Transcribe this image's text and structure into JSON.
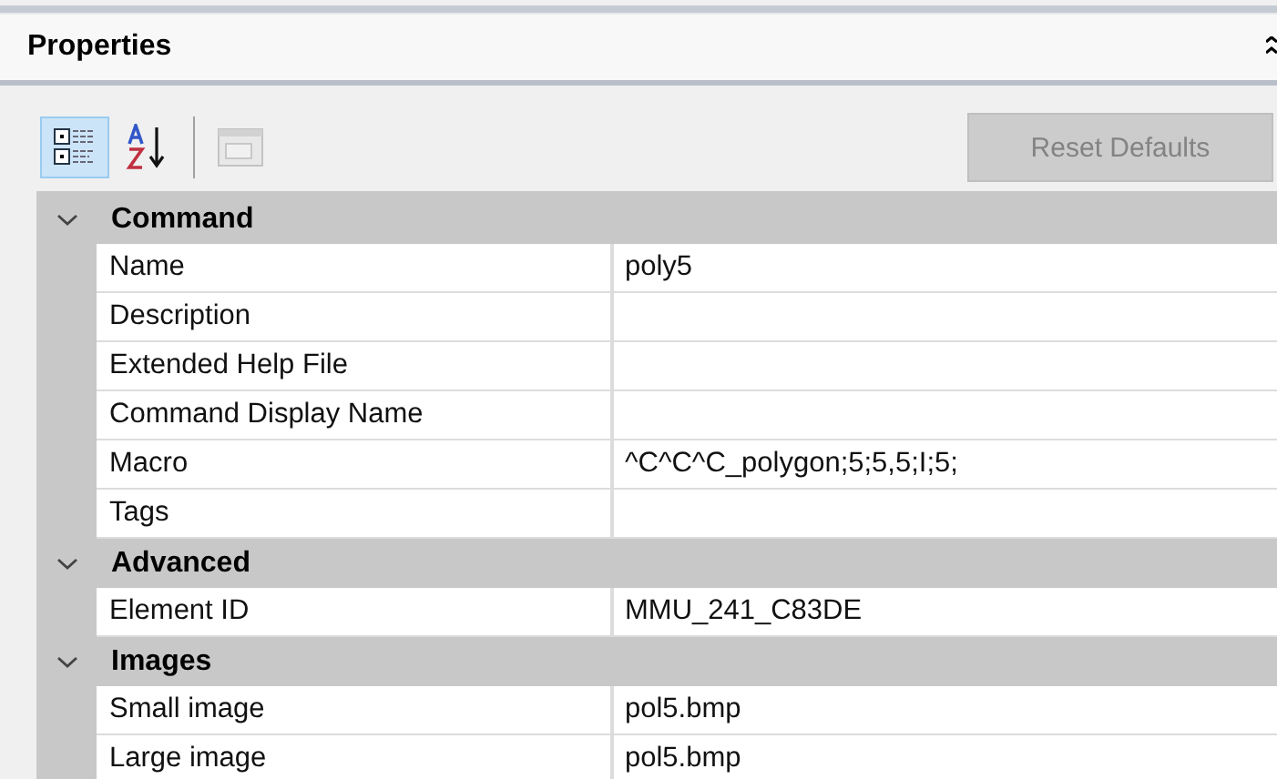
{
  "panel": {
    "title": "Properties"
  },
  "toolbar": [
    {
      "kind": "categorized",
      "selected": true,
      "disabled": false
    },
    {
      "kind": "alphabetical",
      "selected": false,
      "disabled": false
    },
    {
      "kind": "separator"
    },
    {
      "kind": "pages",
      "selected": false,
      "disabled": true
    }
  ],
  "reset_button": {
    "label": "Reset Defaults",
    "disabled": true
  },
  "categories": [
    {
      "name": "Command",
      "expanded": true,
      "properties": [
        {
          "name": "Name",
          "value": "poly5"
        },
        {
          "name": "Description"
        },
        {
          "name": "Extended Help File"
        },
        {
          "name": "Command Display Name"
        },
        {
          "name": "Macro",
          "value": "^C^C^C_polygon;5;5,5;I;5;"
        },
        {
          "name": "Tags"
        }
      ]
    },
    {
      "name": "Advanced",
      "expanded": true,
      "properties": [
        {
          "name": "Element ID",
          "value": "MMU_241_C83DE"
        }
      ]
    },
    {
      "name": "Images",
      "expanded": true,
      "properties": [
        {
          "name": "Small image",
          "value": "pol5.bmp"
        },
        {
          "name": "Large image",
          "value": "pol5.bmp"
        }
      ]
    }
  ]
}
